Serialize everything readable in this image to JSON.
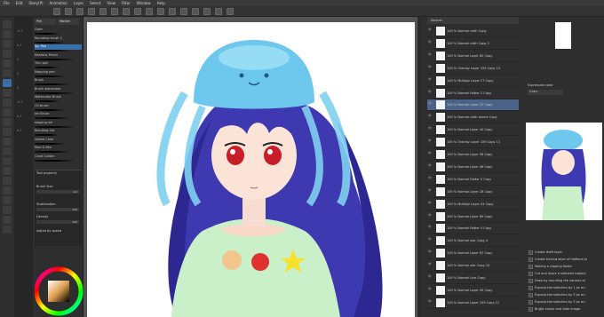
{
  "menu": [
    "File",
    "Edit",
    "Story(P)",
    "Animation",
    "Layer",
    "Select",
    "View",
    "Filter",
    "Window",
    "Help"
  ],
  "brush_tabs": [
    "Pen",
    "Marker"
  ],
  "brushes": [
    "Gpen",
    "Rounding brush 2",
    "Sp. Pen",
    "Realistic Pencil",
    "Thin pen",
    "Mapping pen",
    "Brush",
    "Brush watercolor",
    "Watercolor Brush",
    "Oil brush",
    "Ink Brush",
    "shaping ink",
    "Blending Gel",
    "Softed Color",
    "Real G-Pen",
    "Chalk Cotton"
  ],
  "left_numbers": [
    "-0.7",
    "0.1",
    "1",
    "2",
    "3",
    "-0.7",
    "0.1",
    "0.2"
  ],
  "tool_property": {
    "title": "Tool property",
    "brush_size_label": "Brush Size",
    "brush_size": "4.0",
    "stabilization_label": "Stabilization",
    "stabilization": "100",
    "density_label": "Density",
    "density": "100",
    "adjust_label": "Adjust by speed"
  },
  "layers": [
    "100 % Normal cloth Copy",
    "100 % Normal cloth Copy 2",
    "100 % Normal Layer 60 Copy",
    "100 % Overlay Layer 159 Copy 10",
    "100 % Multiply Layer 27 Copy",
    "100 % Normal Folder 2 Copy",
    "100 % Normal Layer 22 Copy",
    "100 % Normal cloth anime Copy",
    "100 % Normal Layer 40 Copy",
    "100 % Overlay Layer 159 Copy 11",
    "100 % Normal Layer 98 Copy",
    "100 % Normal Layer 46 Copy",
    "100 % Normal Folder 5 Copy",
    "100 % Normal Layer 28 Copy",
    "100 % Multiply Layer 34 Copy",
    "100 % Normal Layer 89 Copy",
    "100 % Normal Folder 4 Copy",
    "100 % Normal star Copy 4",
    "100 % Normal Layer 87 Copy",
    "100 % Normal star Copy 10",
    "100 % Normal Line Copy",
    "100 % Normal Layer 49 Copy",
    "100 % Normal Layer 159 Copy 12"
  ],
  "layer_mode": "Normal",
  "expression_label": "Expression color",
  "expression_value": "Color",
  "history": [
    "Create draft layer",
    "Create tracing layer of halftone pl",
    "Making a clipping folder",
    "Cut and move a selected subject",
    "Draw by rounding the corners of",
    "Expand the selection by 1 px arr",
    "Expand the selection by 3 px arr",
    "Expand the selection by 3 px arr",
    "Bright colour and fade image"
  ],
  "colors": {
    "accent": "#3b6fa8",
    "bg": "#2b2b2b",
    "hair": "#3e39b0",
    "jelly": "#6ec8ee",
    "shirt": "#c9f0c8"
  }
}
